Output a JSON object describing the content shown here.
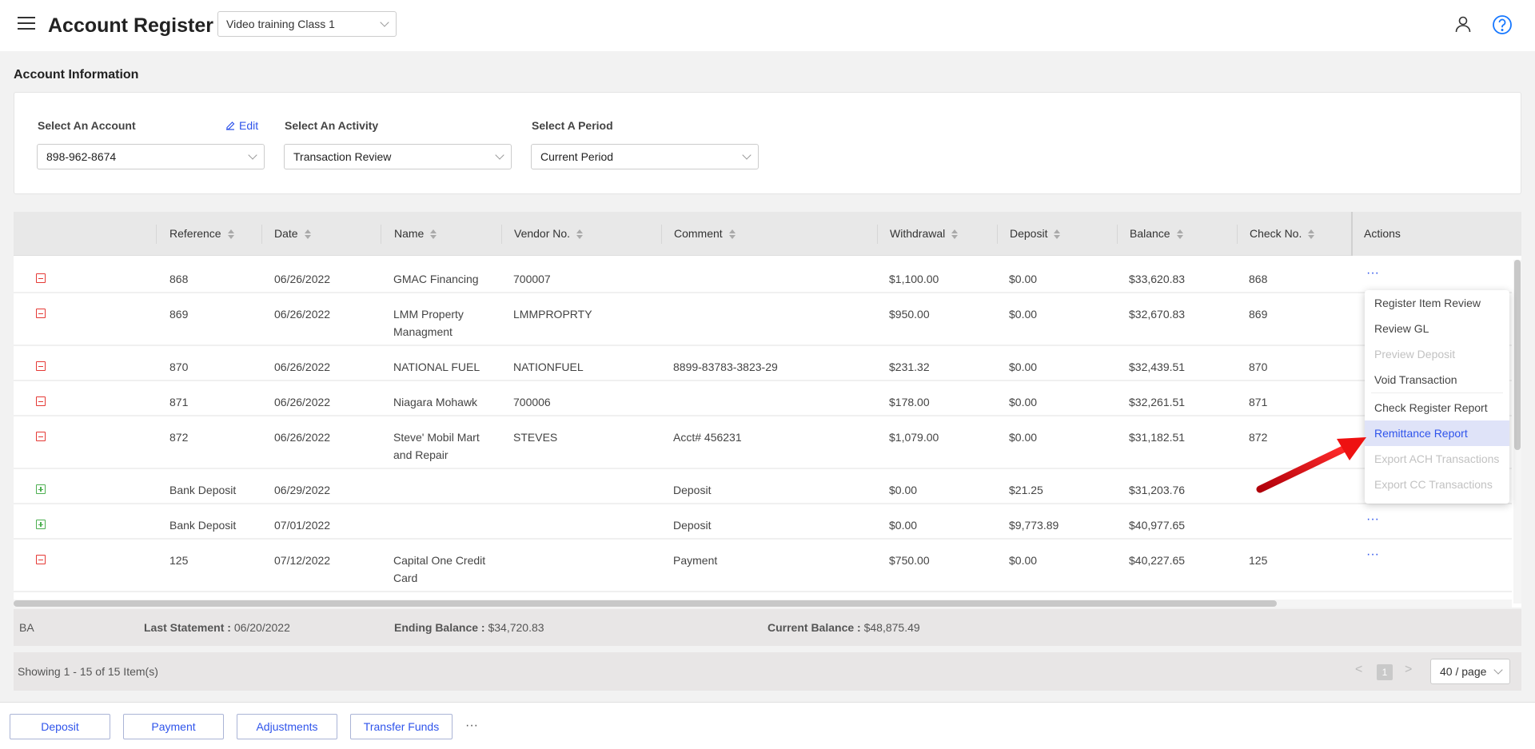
{
  "header": {
    "title": "Account Register",
    "class_select": "Video training Class 1"
  },
  "account_info": {
    "section_title": "Account Information",
    "account_label": "Select An Account",
    "edit_label": "Edit",
    "account_value": "898-962-8674",
    "activity_label": "Select An Activity",
    "activity_value": "Transaction Review",
    "period_label": "Select A Period",
    "period_value": "Current Period"
  },
  "table": {
    "columns": [
      "Reference",
      "Date",
      "Name",
      "Vendor No.",
      "Comment",
      "Withdrawal",
      "Deposit",
      "Balance",
      "Check No."
    ],
    "actions_label": "Actions",
    "more_label": "···",
    "rows": [
      {
        "type": "minus",
        "reference": "868",
        "date": "06/26/2022",
        "name": "GMAC Financing",
        "name2": "",
        "vendor": "700007",
        "comment": "",
        "withdrawal": "$1,100.00",
        "deposit": "$0.00",
        "balance": "$33,620.83",
        "check": "868",
        "dots": true
      },
      {
        "type": "minus",
        "reference": "869",
        "date": "06/26/2022",
        "name": "LMM Property",
        "name2": "Managment",
        "vendor": "LMMPROPRTY",
        "comment": "",
        "withdrawal": "$950.00",
        "deposit": "$0.00",
        "balance": "$32,670.83",
        "check": "869",
        "dots": false
      },
      {
        "type": "minus",
        "reference": "870",
        "date": "06/26/2022",
        "name": "NATIONAL FUEL",
        "name2": "",
        "vendor": "NATIONFUEL",
        "comment": "8899-83783-3823-29",
        "withdrawal": "$231.32",
        "deposit": "$0.00",
        "balance": "$32,439.51",
        "check": "870",
        "dots": false
      },
      {
        "type": "minus",
        "reference": "871",
        "date": "06/26/2022",
        "name": "Niagara Mohawk",
        "name2": "",
        "vendor": "700006",
        "comment": "",
        "withdrawal": "$178.00",
        "deposit": "$0.00",
        "balance": "$32,261.51",
        "check": "871",
        "dots": false
      },
      {
        "type": "minus",
        "reference": "872",
        "date": "06/26/2022",
        "name": "Steve' Mobil Mart",
        "name2": "and Repair",
        "vendor": "STEVES",
        "comment": "Acct# 456231",
        "withdrawal": "$1,079.00",
        "deposit": "$0.00",
        "balance": "$31,182.51",
        "check": "872",
        "dots": false
      },
      {
        "type": "plus",
        "reference": "Bank Deposit",
        "date": "06/29/2022",
        "name": "",
        "name2": "",
        "vendor": "",
        "comment": "Deposit",
        "withdrawal": "$0.00",
        "deposit": "$21.25",
        "balance": "$31,203.76",
        "check": "",
        "dots": false
      },
      {
        "type": "plus",
        "reference": "Bank Deposit",
        "date": "07/01/2022",
        "name": "",
        "name2": "",
        "vendor": "",
        "comment": "Deposit",
        "withdrawal": "$0.00",
        "deposit": "$9,773.89",
        "balance": "$40,977.65",
        "check": "",
        "dots": true
      },
      {
        "type": "minus",
        "reference": "125",
        "date": "07/12/2022",
        "name": "Capital One Credit",
        "name2": "Card",
        "vendor": "",
        "comment": "Payment",
        "withdrawal": "$750.00",
        "deposit": "$0.00",
        "balance": "$40,227.65",
        "check": "125",
        "dots": true
      }
    ]
  },
  "summary": {
    "code": "BA",
    "last_statement_label": "Last Statement :",
    "last_statement_value": "06/20/2022",
    "ending_balance_label": "Ending Balance :",
    "ending_balance_value": "$34,720.83",
    "current_balance_label": "Current Balance :",
    "current_balance_value": "$48,875.49"
  },
  "pagination": {
    "showing": "Showing 1 - 15 of 15 Item(s)",
    "prev": "<",
    "page": "1",
    "next": ">",
    "page_size": "40 / page"
  },
  "footer": {
    "buttons": [
      "Deposit",
      "Payment",
      "Adjustments",
      "Transfer Funds"
    ],
    "more": "···"
  },
  "menu": {
    "items": [
      {
        "label": "Register Item Review",
        "state": "normal"
      },
      {
        "label": "Review GL",
        "state": "normal"
      },
      {
        "label": "Preview Deposit",
        "state": "disabled"
      },
      {
        "label": "Void Transaction",
        "state": "normal"
      },
      {
        "label": "Check Register Report",
        "state": "normal"
      },
      {
        "label": "Remittance Report",
        "state": "active"
      },
      {
        "label": "Export ACH Transactions",
        "state": "disabled"
      },
      {
        "label": "Export CC Transactions",
        "state": "disabled"
      }
    ]
  },
  "colors": {
    "accent": "#2f54eb",
    "withdrawal_icon": "#e53935",
    "deposit_icon": "#4caf50",
    "annotation_arrow": "#e8141c"
  }
}
